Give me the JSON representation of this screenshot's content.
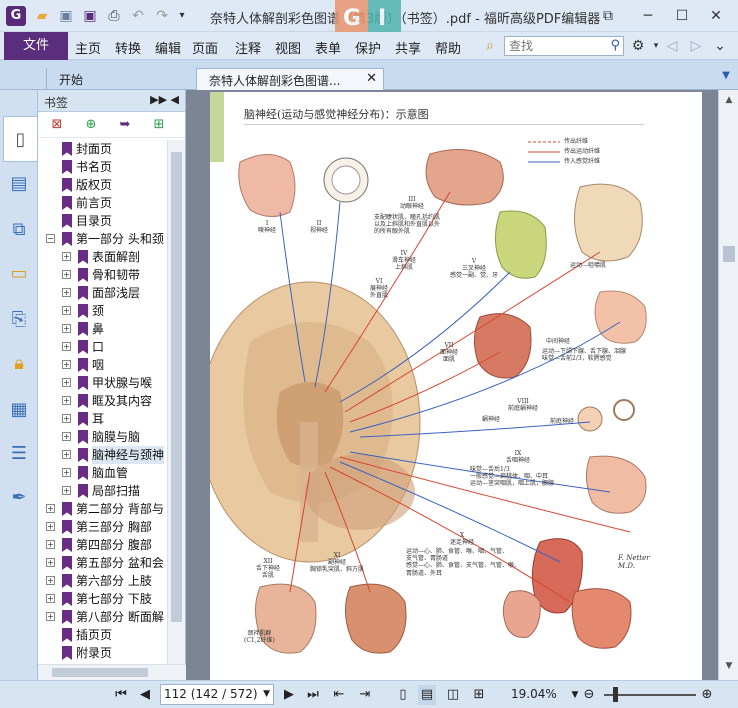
{
  "window": {
    "title": "奈特人体解剖彩色图谱（第3版）（书签）.pdf - 福昕高级PDF编辑器",
    "watermark_left": "G",
    "watermark_right": "I"
  },
  "quick_access": {
    "icons": [
      "app-logo-icon",
      "open-folder-icon",
      "save-icon",
      "save-as-icon",
      "print-icon",
      "undo-icon",
      "redo-icon",
      "customize-dropdown-icon"
    ]
  },
  "window_controls": [
    "restore-layout-icon",
    "minimize-icon",
    "maximize-icon",
    "close-icon"
  ],
  "menu": {
    "file": "文件",
    "items": [
      "主页",
      "转换",
      "编辑",
      "页面",
      "注释",
      "视图",
      "表单",
      "保护",
      "共享",
      "帮助"
    ],
    "search_placeholder": "查找"
  },
  "tabs": [
    {
      "label": "开始"
    },
    {
      "label": "奈特人体解剖彩色图谱..."
    }
  ],
  "bookmarks_panel": {
    "title": "书签",
    "items": [
      {
        "label": "封面页",
        "level": 0,
        "expandable": false
      },
      {
        "label": "书名页",
        "level": 0,
        "expandable": false
      },
      {
        "label": "版权页",
        "level": 0,
        "expandable": false
      },
      {
        "label": "前言页",
        "level": 0,
        "expandable": false
      },
      {
        "label": "目录页",
        "level": 0,
        "expandable": false
      },
      {
        "label": "第一部分 头和颈",
        "level": 0,
        "expandable": true,
        "expanded": true
      },
      {
        "label": "表面解剖",
        "level": 1,
        "expandable": true
      },
      {
        "label": "骨和韧带",
        "level": 1,
        "expandable": true
      },
      {
        "label": "面部浅层",
        "level": 1,
        "expandable": true
      },
      {
        "label": "颈",
        "level": 1,
        "expandable": true
      },
      {
        "label": "鼻",
        "level": 1,
        "expandable": true
      },
      {
        "label": "口",
        "level": 1,
        "expandable": true
      },
      {
        "label": "咽",
        "level": 1,
        "expandable": true
      },
      {
        "label": "甲状腺与喉",
        "level": 1,
        "expandable": true
      },
      {
        "label": "眶及其内容",
        "level": 1,
        "expandable": true
      },
      {
        "label": "耳",
        "level": 1,
        "expandable": true
      },
      {
        "label": "脑膜与脑",
        "level": 1,
        "expandable": true
      },
      {
        "label": "脑神经与颈神",
        "level": 1,
        "expandable": true,
        "selected": true
      },
      {
        "label": "脑血管",
        "level": 1,
        "expandable": true
      },
      {
        "label": "局部扫描",
        "level": 1,
        "expandable": true
      },
      {
        "label": "第二部分 背部与",
        "level": 0,
        "expandable": true
      },
      {
        "label": "第三部分 胸部",
        "level": 0,
        "expandable": true
      },
      {
        "label": "第四部分 腹部",
        "level": 0,
        "expandable": true
      },
      {
        "label": "第五部分 盆和会",
        "level": 0,
        "expandable": true
      },
      {
        "label": "第六部分 上肢",
        "level": 0,
        "expandable": true
      },
      {
        "label": "第七部分 下肢",
        "level": 0,
        "expandable": true
      },
      {
        "label": "第八部分 断面解",
        "level": 0,
        "expandable": true
      },
      {
        "label": "插页页",
        "level": 0,
        "expandable": false
      },
      {
        "label": "附录页",
        "level": 0,
        "expandable": false
      }
    ]
  },
  "page": {
    "heading": "脑神经(运动与感觉神经分布)：示意图",
    "legend": [
      "传出纤维",
      "传出运动纤维",
      "传入感觉纤维"
    ],
    "labels": {
      "olfactory": "I\n嗅神经",
      "optic": "II\n视神经",
      "oculomotor": "III\n动眼神经",
      "oculomotor_desc": "支配睫状肌、瞳孔括约肌\n以及上斜肌和外直肌以外\n的所有眼外肌",
      "trochlear": "IV\n滑车神经\n上斜肌",
      "trigeminal": "V\n三叉神经\n感觉一副、觉、牙",
      "abducens": "VI\n展神经\n外直肌",
      "masticatory": "运动—咀嚼肌",
      "facial": "VII\n面神经\n面肌",
      "intermediate": "中间神经",
      "intermediate_desc": "运动—下颌下腺、舌下腺、泪腺\n味觉—舌前2/3，软腭感觉",
      "vestibulocochlear": "VIII\n前庭蜗神经",
      "cochlear": "蜗神经",
      "vestibular": "前庭神经",
      "glossopharyngeal": "IX\n舌咽神经",
      "glossopharyngeal_desc": "味觉—舌后1/3\n一般感觉—扁桃体、咽、中耳\n运动—茎突咽肌，咽上肌，腮腺",
      "vagus": "X\n迷走神经",
      "vagus_desc": "运动—心、肺、食管、喉、咽、气管、\n支气管、胃肠道\n感觉—心、肺、食管、支气管、气管、喉、\n胃肠道、外耳",
      "hypoglossal": "XII\n舌下神经\n舌肌",
      "accessory": "XI\n副神经\n胸锁乳突肌、斜方肌",
      "cervical": "颈袢肌群\n(C1,2纤维)",
      "signature": "F. Netter\nM.D."
    }
  },
  "statusbar": {
    "page_display": "112 (142 / 572)",
    "zoom": "19.04%",
    "zoom_fraction": 0.12
  }
}
